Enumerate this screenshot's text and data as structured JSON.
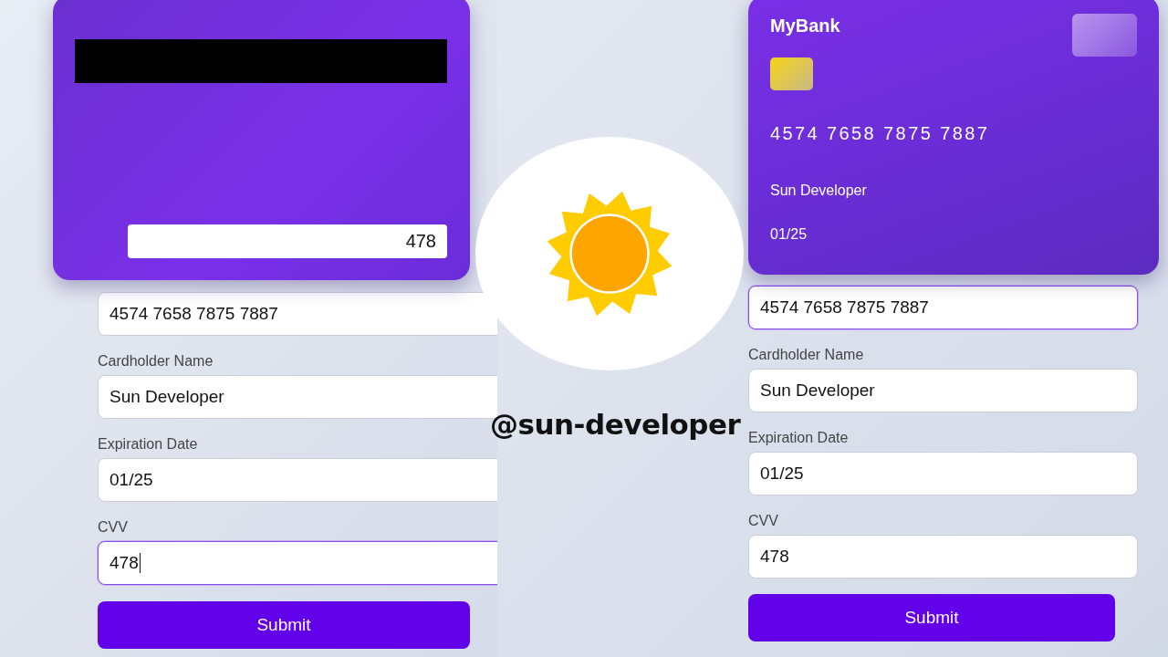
{
  "screens": [
    {
      "card": {
        "kind": "back",
        "cvv": "478"
      },
      "fields": [
        {
          "value": "4574 7658 7875 7887",
          "focused": false
        },
        {
          "label": "Cardholder Name",
          "value": "Sun Developer",
          "focused": false
        },
        {
          "label": "Expiration Date",
          "value": "01/25",
          "focused": false
        },
        {
          "label": "CVV",
          "value": "478",
          "focused": true
        }
      ],
      "button": "Submit"
    },
    {
      "card": {
        "kind": "front",
        "brand": "MyBank",
        "number": "4574 7658 7875 7887",
        "name": "Sun Developer",
        "expiry": "01/25"
      },
      "fields": [
        {
          "value": "4574 7658 7875 7887",
          "focused": true
        },
        {
          "label": "Cardholder Name",
          "value": "Sun Developer",
          "focused": false
        },
        {
          "label": "Expiration Date",
          "value": "01/25",
          "focused": false
        },
        {
          "label": "CVV",
          "value": "478",
          "focused": false
        }
      ],
      "button": "Submit"
    }
  ],
  "logo": {
    "handle": "@sun-developer"
  }
}
